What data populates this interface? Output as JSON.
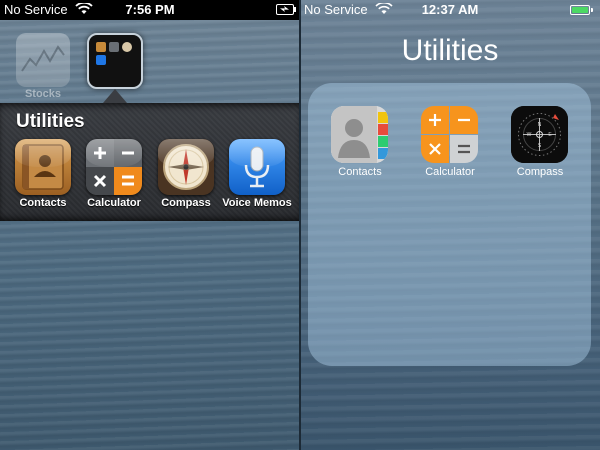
{
  "left_screen": {
    "status": {
      "carrier": "No Service",
      "time": "7:56 PM"
    },
    "background_label": "Stocks",
    "folder": {
      "title": "Utilities",
      "apps": [
        {
          "label": "Contacts",
          "icon": "contacts-book-icon"
        },
        {
          "label": "Calculator",
          "icon": "calculator-icon"
        },
        {
          "label": "Compass",
          "icon": "compass-icon"
        },
        {
          "label": "Voice Memos",
          "icon": "microphone-icon"
        }
      ]
    }
  },
  "right_screen": {
    "status": {
      "carrier": "No Service",
      "time": "12:37 AM"
    },
    "folder": {
      "title": "Utilities",
      "apps": [
        {
          "label": "Contacts",
          "icon": "contacts-silhouette-icon"
        },
        {
          "label": "Calculator",
          "icon": "calculator-icon"
        },
        {
          "label": "Compass",
          "icon": "compass-icon"
        }
      ]
    }
  },
  "colors": {
    "ios7_calculator_orange": "#f7941d",
    "ios7_battery_green": "#4cd964",
    "voice_memos_blue": "#1f77e6"
  }
}
